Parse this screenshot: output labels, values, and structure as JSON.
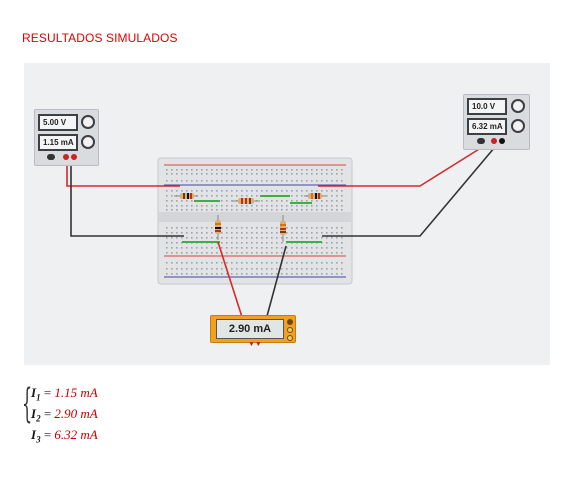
{
  "title": "RESULTADOS SIMULADOS",
  "supply_left": {
    "voltage": "5.00 V",
    "current": "1.15 mA"
  },
  "supply_right": {
    "voltage": "10.0 V",
    "current": "6.32 mA"
  },
  "multimeter": {
    "reading": "2.90 mA"
  },
  "results": [
    {
      "var": "I",
      "sub": "1",
      "value": "1.15 mA"
    },
    {
      "var": "I",
      "sub": "2",
      "value": "2.90 mA"
    },
    {
      "var": "I",
      "sub": "3",
      "value": "6.32 mA"
    }
  ],
  "colors": {
    "title": "#e00000",
    "red_wire": "#d42a2a",
    "black_wire": "#333333",
    "multimeter": "#f1a122",
    "values": "#c00000"
  }
}
